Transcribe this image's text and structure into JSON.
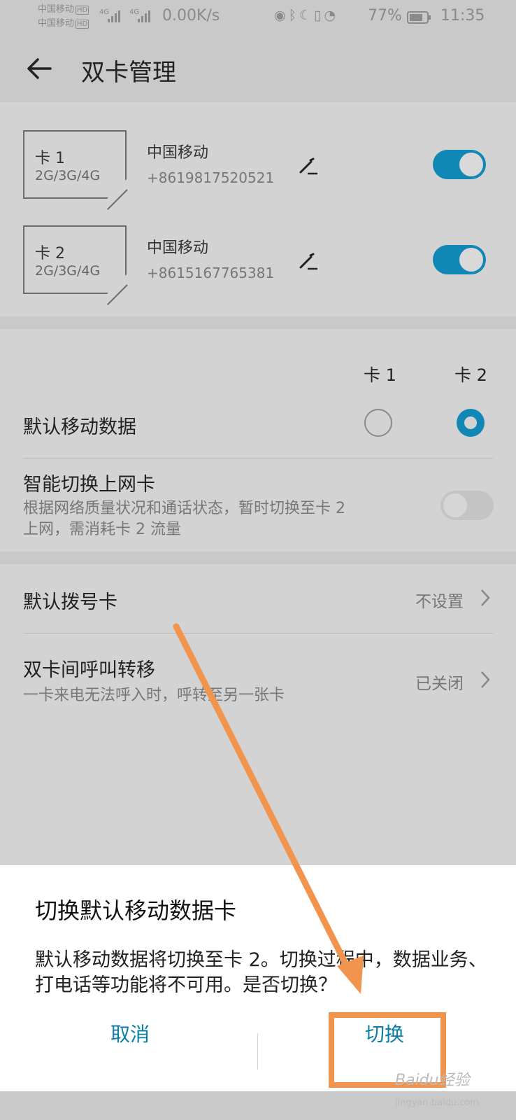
{
  "status_bar": {
    "carrier1": "中国移动",
    "carrier2": "中国移动",
    "hd": "HD",
    "net_type": "4G",
    "net_speed": "0.00K/s",
    "battery": "77%",
    "time": "11:35"
  },
  "header": {
    "title": "双卡管理"
  },
  "sims": [
    {
      "card": "卡 1",
      "network": "2G/3G/4G",
      "carrier": "中国移动",
      "number": "+8619817520521",
      "enabled": true
    },
    {
      "card": "卡 2",
      "network": "2G/3G/4G",
      "carrier": "中国移动",
      "number": "+8615167765381",
      "enabled": true
    }
  ],
  "data_section": {
    "col1": "卡 1",
    "col2": "卡 2",
    "default_data_label": "默认移动数据",
    "smart_switch_label": "智能切换上网卡",
    "smart_switch_desc_line1": "根据网络质量状况和通话状态，暂时切换至卡 2",
    "smart_switch_desc_line2": "上网，需消耗卡 2 流量"
  },
  "call_section": {
    "default_call_label": "默认拨号卡",
    "default_call_value": "不设置",
    "forward_label": "双卡间呼叫转移",
    "forward_desc": "一卡来电无法呼入时，呼转至另一张卡",
    "forward_value": "已关闭"
  },
  "dialog": {
    "title": "切换默认移动数据卡",
    "message": "默认移动数据将切换至卡 2。切换过程中，数据业务、打电话等功能将不可用。是否切换？",
    "cancel": "取消",
    "confirm": "切换"
  },
  "watermark": {
    "text": "Baidu经验",
    "url": "jingyan.baidu.com"
  },
  "colors": {
    "accent": "#1087b4",
    "annotation": "#f0944e"
  }
}
